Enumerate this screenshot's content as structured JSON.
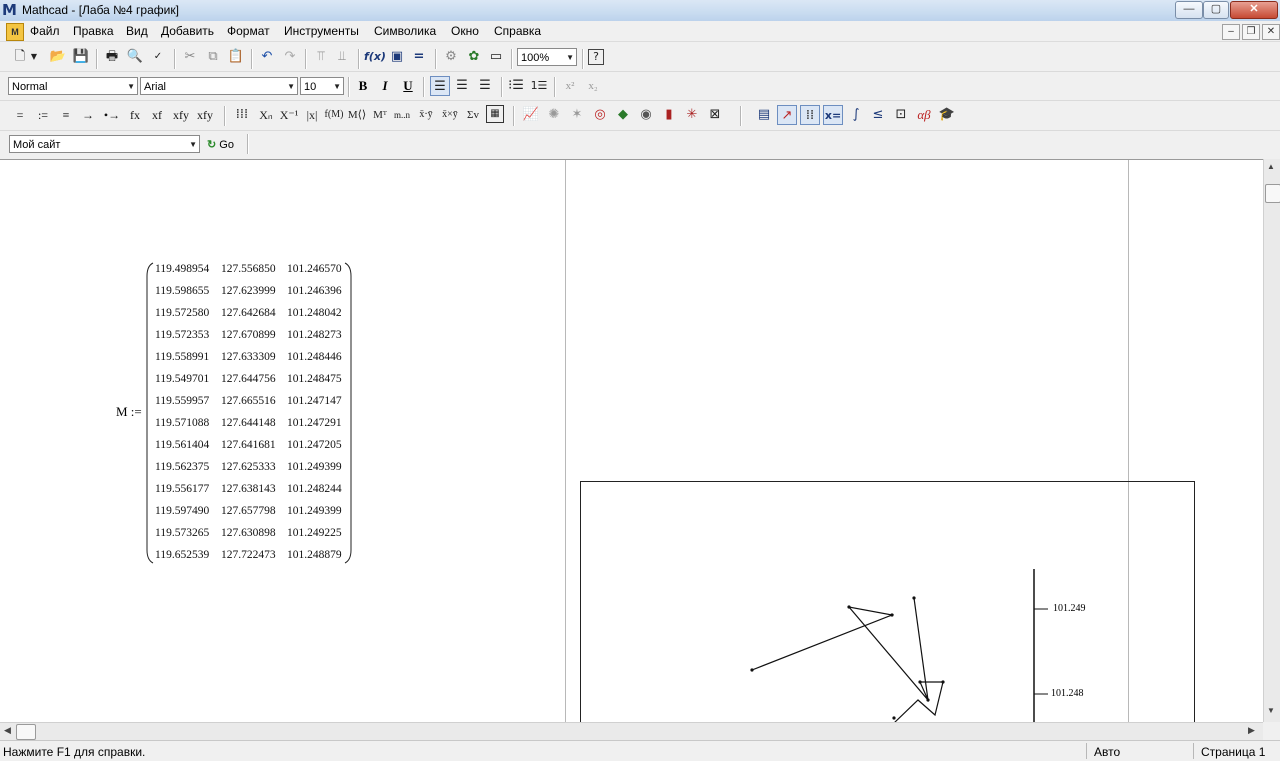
{
  "window": {
    "title": "Mathcad - [Лаба №4 график]",
    "min_glyph": "—",
    "max_glyph": "▢",
    "close_glyph": "✕"
  },
  "menu": {
    "items": [
      "Файл",
      "Правка",
      "Вид",
      "Добавить",
      "Формат",
      "Инструменты",
      "Символика",
      "Окно",
      "Справка"
    ],
    "doc_min": "–",
    "doc_restore": "❐",
    "doc_close": "✕"
  },
  "toolbar_standard": {
    "zoom": "100%"
  },
  "toolbar_formatting": {
    "style": "Normal",
    "font": "Arial",
    "size": "10",
    "bold": "B",
    "italic": "I",
    "underline": "U",
    "superscript": "x²",
    "subscript": "x₂"
  },
  "toolbar_math": {
    "ops": [
      "=",
      ":=",
      "≡",
      "→",
      "•→",
      "fx",
      "xf",
      "xfy",
      "xfy"
    ]
  },
  "toolbar_resources": {
    "site": "Мой сайт",
    "go_label": "Go"
  },
  "worksheet": {
    "matrix_name": "M :=",
    "matrix_rows": [
      [
        "119.498954",
        "127.556850",
        "101.246570"
      ],
      [
        "119.598655",
        "127.623999",
        "101.246396"
      ],
      [
        "119.572580",
        "127.642684",
        "101.248042"
      ],
      [
        "119.572353",
        "127.670899",
        "101.248273"
      ],
      [
        "119.558991",
        "127.633309",
        "101.248446"
      ],
      [
        "119.549701",
        "127.644756",
        "101.248475"
      ],
      [
        "119.559957",
        "127.665516",
        "101.247147"
      ],
      [
        "119.571088",
        "127.644148",
        "101.247291"
      ],
      [
        "119.561404",
        "127.641681",
        "101.247205"
      ],
      [
        "119.562375",
        "127.625333",
        "101.249399"
      ],
      [
        "119.556177",
        "127.638143",
        "101.248244"
      ],
      [
        "119.597490",
        "127.657798",
        "101.249399"
      ],
      [
        "119.573265",
        "127.630898",
        "101.249225"
      ],
      [
        "119.652539",
        "127.722473",
        "101.248879"
      ]
    ],
    "plot_ticks": [
      "101.249",
      "101.248"
    ]
  },
  "status": {
    "help": "Нажмите F1 для справки.",
    "mode": "Авто",
    "page": "Страница 1"
  }
}
